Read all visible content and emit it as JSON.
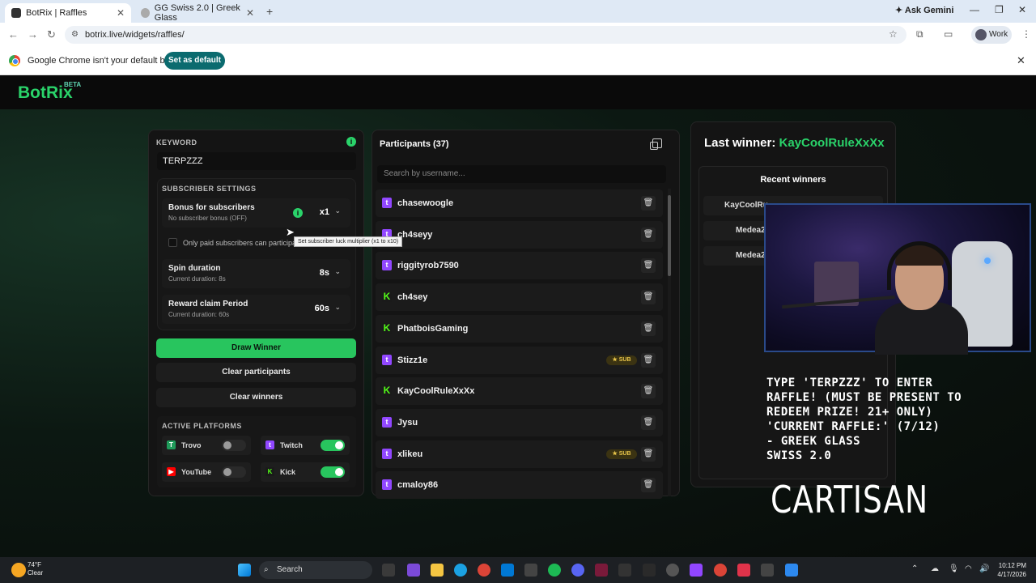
{
  "browser": {
    "tabs": [
      {
        "title": "BotRix | Raffles",
        "active": true
      },
      {
        "title": "GG Swiss 2.0 | Greek Glass",
        "active": false
      }
    ],
    "new_tab": "+",
    "gemini": "Ask Gemini",
    "url": "botrix.live/widgets/raffles/",
    "profile": "Work",
    "infobar_text": "Google Chrome isn't your default browser",
    "set_default": "Set as default"
  },
  "app": {
    "logo": "BotRix",
    "beta": "BETA",
    "keyword": {
      "label": "KEYWORD",
      "value": "TERPZZZ"
    },
    "subscriber_settings": {
      "label": "SUBSCRIBER SETTINGS",
      "bonus": {
        "title": "Bonus for subscribers",
        "subtitle": "No subscriber bonus (OFF)",
        "value": "x1"
      },
      "paid_only": "Only paid subscribers can participate",
      "tooltip": "Set subscriber luck multiplier (x1 to x10)",
      "spin": {
        "title": "Spin duration",
        "subtitle": "Current duration: 8s",
        "value": "8s"
      },
      "reward": {
        "title": "Reward claim Period",
        "subtitle": "Current duration: 60s",
        "value": "60s"
      }
    },
    "buttons": {
      "draw": "Draw Winner",
      "clear_participants": "Clear participants",
      "clear_winners": "Clear winners"
    },
    "platforms": {
      "label": "ACTIVE PLATFORMS",
      "items": [
        {
          "name": "Trovo",
          "enabled": false
        },
        {
          "name": "Twitch",
          "enabled": true
        },
        {
          "name": "YouTube",
          "enabled": false
        },
        {
          "name": "Kick",
          "enabled": true
        }
      ]
    },
    "participants": {
      "title": "Participants (37)",
      "search_placeholder": "Search by username...",
      "rows": [
        {
          "name": "chasewoogle",
          "platform": "twitch",
          "sub": ""
        },
        {
          "name": "ch4seyy",
          "platform": "twitch",
          "sub": ""
        },
        {
          "name": "riggityrob7590",
          "platform": "twitch",
          "sub": ""
        },
        {
          "name": "ch4sey",
          "platform": "kick",
          "sub": ""
        },
        {
          "name": "PhatboisGaming",
          "platform": "kick",
          "sub": ""
        },
        {
          "name": "Stizz1e",
          "platform": "twitch",
          "sub": "★ SUB"
        },
        {
          "name": "KayCoolRuleXxXx",
          "platform": "kick",
          "sub": ""
        },
        {
          "name": "Jysu",
          "platform": "twitch",
          "sub": ""
        },
        {
          "name": "xlikeu",
          "platform": "twitch",
          "sub": "★ SUB"
        },
        {
          "name": "cmaloy86",
          "platform": "twitch",
          "sub": ""
        }
      ]
    },
    "last_winner": {
      "label": "Last winner:",
      "name": "KayCoolRuleXxXx"
    },
    "recent_winners": {
      "title": "Recent winners",
      "rows": [
        "KayCoolRu",
        "Medea2",
        "Medea2"
      ]
    }
  },
  "overlay": {
    "text": "TYPE 'TERPZZZ' TO ENTER\nRAFFLE! (MUST BE PRESENT TO\nREDEEM PRIZE! 21+ ONLY)\n'CURRENT RAFFLE:' (7/12)\n- GREEK GLASS\nSWISS 2.0",
    "sponsor": "CARTISAN"
  },
  "taskbar": {
    "temp": "74°F",
    "weather": "Clear",
    "search": "Search",
    "time": "10:12 PM",
    "date": "4/17/2026"
  }
}
